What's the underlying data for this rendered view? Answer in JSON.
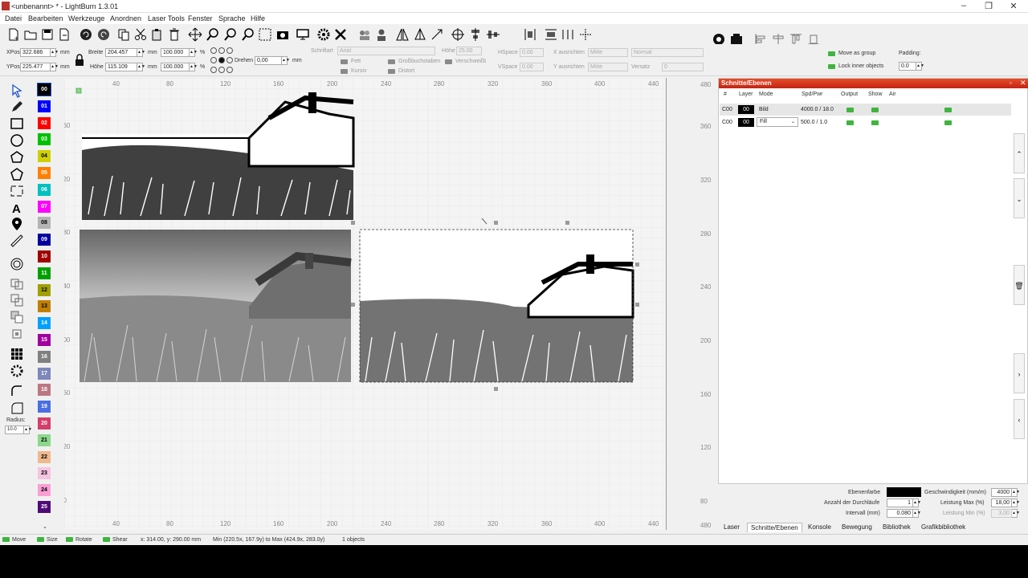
{
  "window": {
    "title": "<unbenannt> * - LightBurn 1.3.01",
    "minimize": "–",
    "maximize": "❐",
    "close": "✕"
  },
  "menu": [
    "Datei",
    "Bearbeiten",
    "Werkzeuge",
    "Anordnen",
    "Laser Tools",
    "Fenster",
    "Sprache",
    "Hilfe"
  ],
  "props": {
    "xpos_label": "XPos",
    "xpos": "322.686",
    "ypos_label": "YPos",
    "ypos": "225.477",
    "mm": "mm",
    "breite_label": "Breite",
    "breite": "204.457",
    "hoehe_label": "Höhe",
    "hoehe": "115.109",
    "pct1": "100.000",
    "pct2": "100.000",
    "pct": "%",
    "drehen_label": "Drehen",
    "drehen": "0,00",
    "drehen_unit": "mm",
    "schriftart_label": "Schriftart",
    "schriftart": "Arial",
    "fett": "Fett",
    "kursiv": "Kursiv",
    "gross": "Großbuchstaben",
    "distort": "Distort",
    "verschweisst": "Verschweißt",
    "hoehe2_label": "Höhe",
    "hoehe2": "25.00",
    "hspace_label": "HSpace",
    "hspace": "0.00",
    "vspace_label": "VSpace",
    "vspace": "0.00",
    "xausr_label": "X ausrichten",
    "xausr": "Mitte",
    "yausr_label": "Y ausrichten",
    "yausr": "Mitte",
    "normal": "Normal",
    "versatz_label": "Versatz",
    "versatz": "0",
    "move_group": "Move as group",
    "lock_inner": "Lock inner objects",
    "padding_label": "Padding:",
    "padding": "0.0"
  },
  "palette": [
    {
      "n": "00",
      "c": "#000000"
    },
    {
      "n": "01",
      "c": "#0000ff"
    },
    {
      "n": "02",
      "c": "#ff0000"
    },
    {
      "n": "03",
      "c": "#00c000"
    },
    {
      "n": "04",
      "c": "#d0d000"
    },
    {
      "n": "05",
      "c": "#ff8000"
    },
    {
      "n": "06",
      "c": "#00c0c0"
    },
    {
      "n": "07",
      "c": "#ff00ff"
    },
    {
      "n": "08",
      "c": "#b4b4b4"
    },
    {
      "n": "09",
      "c": "#0000a0"
    },
    {
      "n": "10",
      "c": "#a00000"
    },
    {
      "n": "11",
      "c": "#00a000"
    },
    {
      "n": "12",
      "c": "#a0a000"
    },
    {
      "n": "13",
      "c": "#c08000"
    },
    {
      "n": "14",
      "c": "#00a0ff"
    },
    {
      "n": "15",
      "c": "#a000a0"
    },
    {
      "n": "16",
      "c": "#808080"
    },
    {
      "n": "17",
      "c": "#7d87b9"
    },
    {
      "n": "18",
      "c": "#bb7784"
    },
    {
      "n": "19",
      "c": "#4a6fe3"
    },
    {
      "n": "20",
      "c": "#d33f6a"
    },
    {
      "n": "21",
      "c": "#8cd78c"
    },
    {
      "n": "22",
      "c": "#f0b98d"
    },
    {
      "n": "23",
      "c": "#f6c4e1"
    },
    {
      "n": "24",
      "c": "#fa9ed4"
    },
    {
      "n": "25",
      "c": "#500a78"
    }
  ],
  "radius_label": "Radius:",
  "radius": "10.0",
  "ruler": {
    "top": [
      "40",
      "80",
      "120",
      "160",
      "200",
      "240",
      "280",
      "320",
      "360",
      "400",
      "440"
    ],
    "left": [
      "360",
      "320",
      "280",
      "240",
      "200",
      "160",
      "120",
      "80"
    ],
    "right": [
      "480",
      "360",
      "320",
      "280",
      "240",
      "200",
      "160",
      "120",
      "80",
      "480"
    ]
  },
  "cuts": {
    "title": "Schnitte/Ebenen",
    "headers": [
      "#",
      "Layer",
      "Mode",
      "Spd/Pwr",
      "Output",
      "Show",
      "Air"
    ],
    "rows": [
      {
        "num": "C00",
        "layer": "00",
        "mode": "Bild",
        "spd": "4000.0 / 18.0"
      },
      {
        "num": "C00",
        "layer": "00",
        "mode": "Fill",
        "spd": "500.0 / 1.0"
      }
    ]
  },
  "params": {
    "ebenenfarbe": "Ebenenfarbe",
    "durchlaeufe": "Anzahl der Durchläufe",
    "durchlaeufe_val": "1",
    "intervall": "Intervall (mm)",
    "intervall_val": "0.080",
    "geschw": "Geschwindigkeit (mm/m)",
    "geschw_val": "4000",
    "lmax": "Leistung Max (%)",
    "lmax_val": "18,00",
    "lmin": "Leistung Min (%)",
    "lmin_val": "3,00"
  },
  "tabs": [
    "Laser",
    "Schnitte/Ebenen",
    "Konsole",
    "Bewegung",
    "Bibliothek",
    "Grafikbibliothek"
  ],
  "status": {
    "move": "Move",
    "size": "Size",
    "rotate": "Rotate",
    "shear": "Shear",
    "coords": "x: 314.00, y: 290.00 mm",
    "range": "Min (220.5x, 167.9y) to Max (424.9x, 283.0y)",
    "objects": "1 objects"
  }
}
